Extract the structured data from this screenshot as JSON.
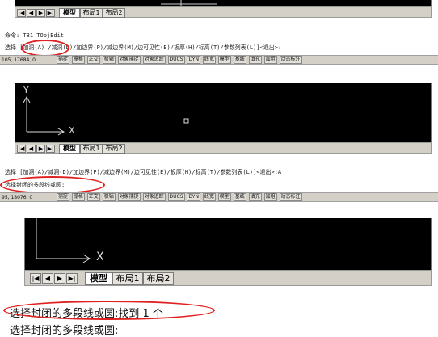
{
  "panel1": {
    "tabs": [
      "模型",
      "布局1",
      "布局2"
    ],
    "command_line1": "命令: T81 TObjEdit",
    "prompt_prefix": "选择",
    "prompt_highlight": "[加洞(A)",
    "prompt_rest": "/减洞(D)/加边界(P)/减边界(M)/边可见性(E)/板厚(H)/标高(T)/参数列表(L)]<退出>:",
    "coords": "105, 17684, 0",
    "status_buttons": [
      "捕捉",
      "栅格",
      "正交",
      "极轴",
      "对象捕捉",
      "对象追踪",
      "DUCS",
      "DYN",
      "线宽",
      "模型",
      "基线",
      "填充",
      "加粗",
      "动态标注"
    ]
  },
  "panel2": {
    "tabs": [
      "模型",
      "布局1",
      "布局2"
    ],
    "command_line1": "选择 [加洞(A)/减洞(D)/加边界(P)/减边界(M)/边可见性(E)/板厚(H)/标高(T)/参数列表(L)]<退出>:A",
    "command_line2": "选择封闭的多段线或圆:",
    "coords": "95, 18076, 0",
    "status_buttons": [
      "捕捉",
      "栅格",
      "正交",
      "极轴",
      "对象捕捉",
      "对象追踪",
      "DUCS",
      "DYN",
      "线宽",
      "模型",
      "基线",
      "填充",
      "加粗",
      "动态标注"
    ]
  },
  "panel3": {
    "tabs": [
      "模型",
      "布局1",
      "布局2"
    ],
    "command_line1": "选择封闭的多段线或圆:找到 1 个",
    "command_line2": "选择封闭的多段线或圆:"
  },
  "axis": {
    "x_label": "X",
    "y_label": "Y"
  },
  "nav_buttons": [
    "|◀",
    "◀",
    "▶",
    "▶|"
  ],
  "colors": {
    "canvas": "#000000",
    "highlight": "#e02020",
    "statusbar": "#d4d0c8"
  }
}
